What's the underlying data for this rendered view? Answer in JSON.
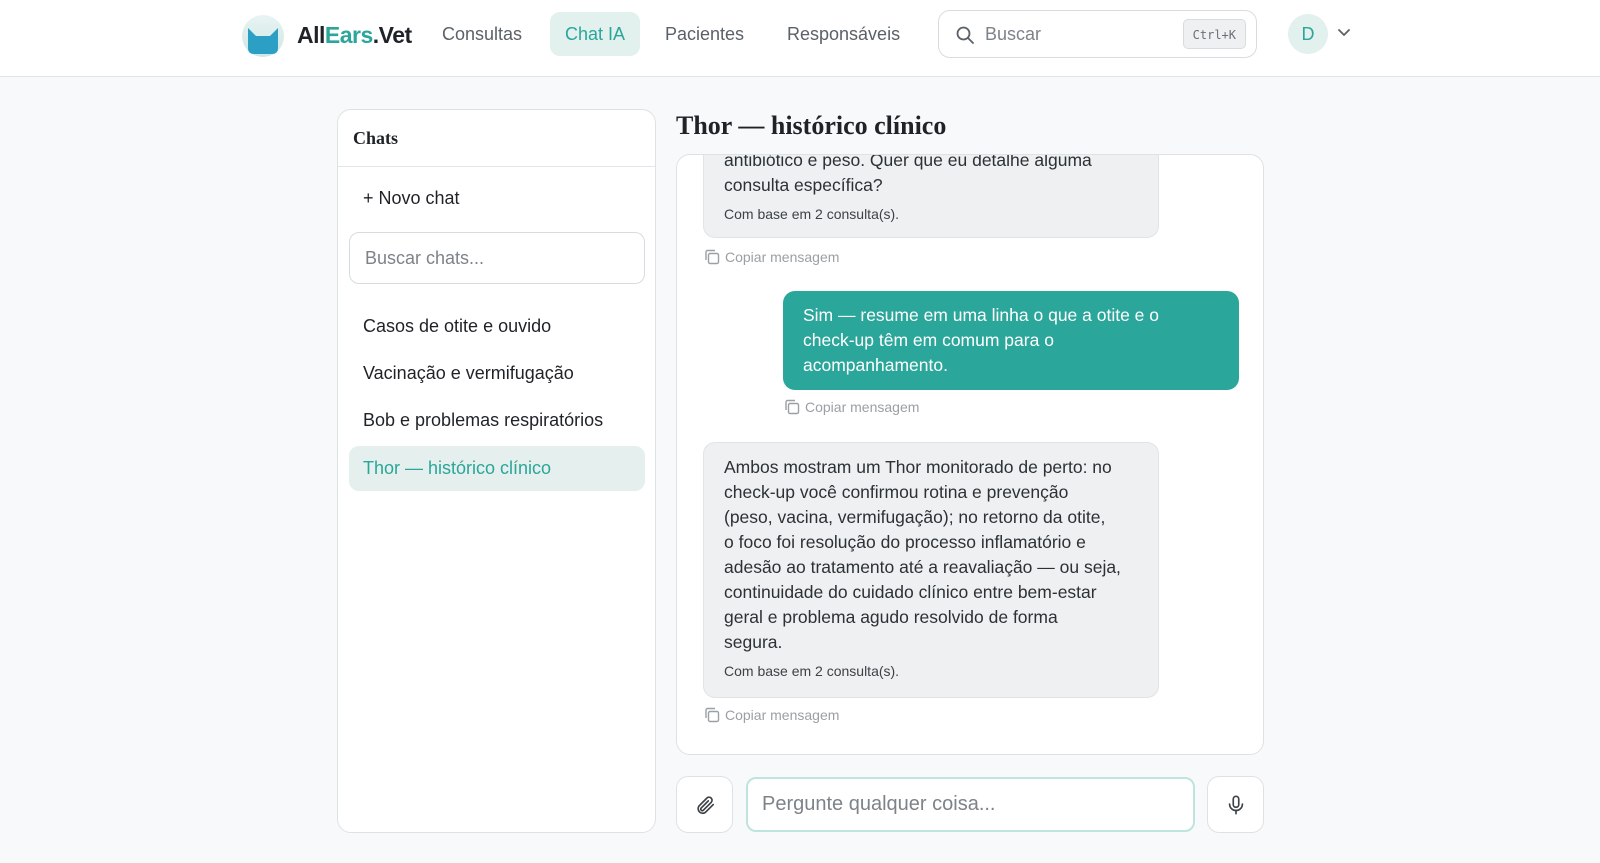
{
  "header": {
    "brand": {
      "part1": "All",
      "part2": "Ears",
      "part3": ".Vet"
    },
    "nav": [
      {
        "label": "Consultas",
        "active": false
      },
      {
        "label": "Chat IA",
        "active": true
      },
      {
        "label": "Pacientes",
        "active": false
      },
      {
        "label": "Responsáveis",
        "active": false
      }
    ],
    "search": {
      "placeholder": "Buscar",
      "shortcut": "Ctrl+K"
    },
    "user": {
      "initial": "D"
    }
  },
  "sidebar": {
    "title": "Chats",
    "new_chat": "+ Novo chat",
    "search_placeholder": "Buscar chats...",
    "items": [
      {
        "label": "Casos de otite e ouvido",
        "active": false
      },
      {
        "label": "Vacinação e vermifugação",
        "active": false
      },
      {
        "label": "Bob e problemas respiratórios",
        "active": false
      },
      {
        "label": "Thor — histórico clínico",
        "active": true
      }
    ]
  },
  "chat": {
    "title": "Thor — histórico clínico",
    "messages": [
      {
        "role": "assistant",
        "lines": [
          "antibiótico e peso. Quer que eu detalhe alguma",
          "consulta específica?"
        ],
        "source": "Com base em 2 consulta(s).",
        "copy": "Copiar mensagem"
      },
      {
        "role": "user",
        "lines": [
          "Sim — resume em uma linha o que a otite e o",
          "check-up têm em comum para o",
          "acompanhamento."
        ],
        "copy": "Copiar mensagem"
      },
      {
        "role": "assistant",
        "lines": [
          "Ambos mostram um Thor monitorado de perto: no",
          "check-up você confirmou rotina e prevenção",
          "(peso, vacina, vermifugação); no retorno da otite,",
          "o foco foi resolução do processo inflamatório e",
          "adesão ao tratamento até a reavaliação — ou seja,",
          "continuidade do cuidado clínico entre bem-estar",
          "geral e problema agudo resolvido de forma",
          "segura."
        ],
        "source": "Com base em 2 consulta(s).",
        "copy": "Copiar mensagem"
      }
    ]
  },
  "composer": {
    "placeholder": "Pergunte qualquer coisa..."
  },
  "icons": [
    "logo-cat-icon",
    "search-icon",
    "chevron-down-icon",
    "copy-icon",
    "paperclip-icon",
    "microphone-icon"
  ],
  "colors": {
    "accent": "#2aa69a",
    "accent_light": "#e2f0ee",
    "background": "#f8f9fa",
    "bubble_ai": "#eef0f1"
  }
}
